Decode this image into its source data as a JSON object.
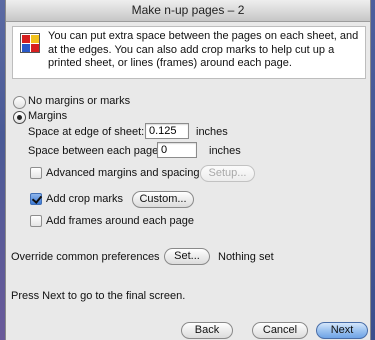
{
  "window": {
    "title": "Make n-up pages – 2"
  },
  "intro": {
    "text": "You can put extra space between the pages on each sheet, and at the edges. You can also add crop marks to help cut up a printed sheet, or lines (frames) around each page."
  },
  "options": {
    "no_margins_label": "No margins or marks",
    "margins_label": "Margins",
    "selected": "margins"
  },
  "margins": {
    "edge_label": "Space at edge of sheet:",
    "edge_value": "0.125",
    "edge_unit": "inches",
    "between_label": "Space between each page:",
    "between_value": "0",
    "between_unit": "inches"
  },
  "checkboxes": {
    "advanced_label": "Advanced margins and spacing",
    "advanced_checked": false,
    "setup_button": "Setup...",
    "crop_label": "Add crop marks",
    "crop_checked": true,
    "custom_button": "Custom...",
    "frames_label": "Add frames around each page",
    "frames_checked": false
  },
  "override": {
    "label": "Override common preferences",
    "set_button": "Set...",
    "status": "Nothing set"
  },
  "footer": {
    "hint": "Press Next to go to the final screen.",
    "back_button": "Back",
    "cancel_button": "Cancel",
    "next_button": "Next"
  },
  "colors": {
    "desktop": "#4a5a96",
    "default_button": "#6fa4e6",
    "window_bg": "#e9e9e9"
  }
}
